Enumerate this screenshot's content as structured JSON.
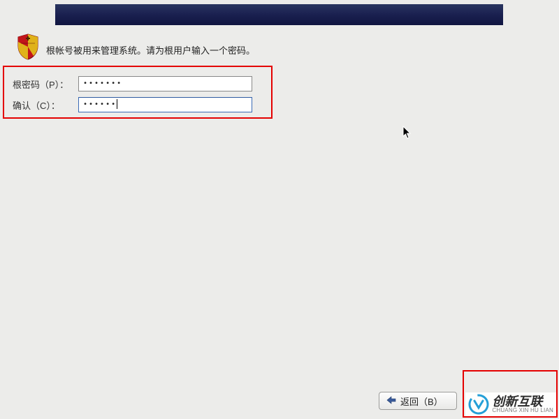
{
  "instruction": "根帐号被用来管理系统。请为根用户输入一个密码。",
  "form": {
    "root_password_label": "根密码（P）：",
    "root_password_value": "•••••••",
    "confirm_label": "确认（C）：",
    "confirm_value": "••••••"
  },
  "buttons": {
    "back_label": "返回（B）"
  },
  "watermark": {
    "cn": "创新互联",
    "en": "CHUANG XIN HU LIAN"
  },
  "icons": {
    "shield": "shield-icon",
    "arrow_left": "arrow-left-icon",
    "cursor": "mouse-cursor-icon"
  }
}
